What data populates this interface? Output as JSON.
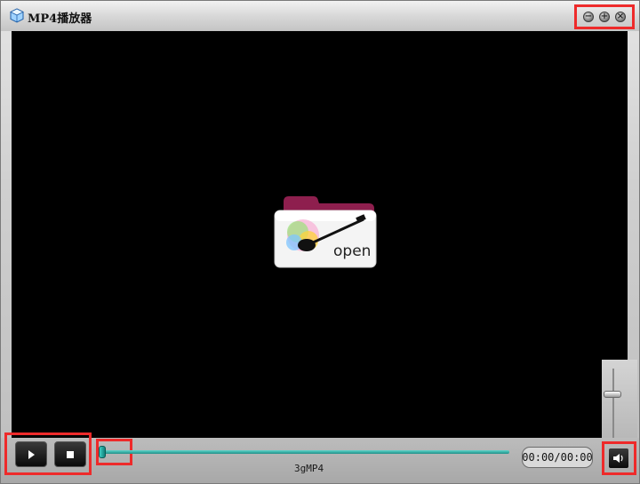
{
  "window": {
    "title": "MP4播放器",
    "icon": "app-cube-icon"
  },
  "window_controls": [
    {
      "name": "minimize",
      "icon": "minimize-icon",
      "glyph": "−"
    },
    {
      "name": "maximize",
      "icon": "maximize-icon",
      "glyph": "+"
    },
    {
      "name": "close",
      "icon": "close-icon",
      "glyph": "×"
    }
  ],
  "video": {
    "open_label": "open",
    "open_icon": "open-folder-icon"
  },
  "volume": {
    "level": 0.65,
    "icon": "speaker-icon"
  },
  "playback": {
    "play_icon": "play-icon",
    "stop_icon": "stop-icon",
    "filename": "3gMP4",
    "time": "00:00/00:00",
    "progress": 0
  },
  "colors": {
    "highlight": "#ee2a2a",
    "seek": "#2fb3aa",
    "video_bg": "#000000"
  }
}
